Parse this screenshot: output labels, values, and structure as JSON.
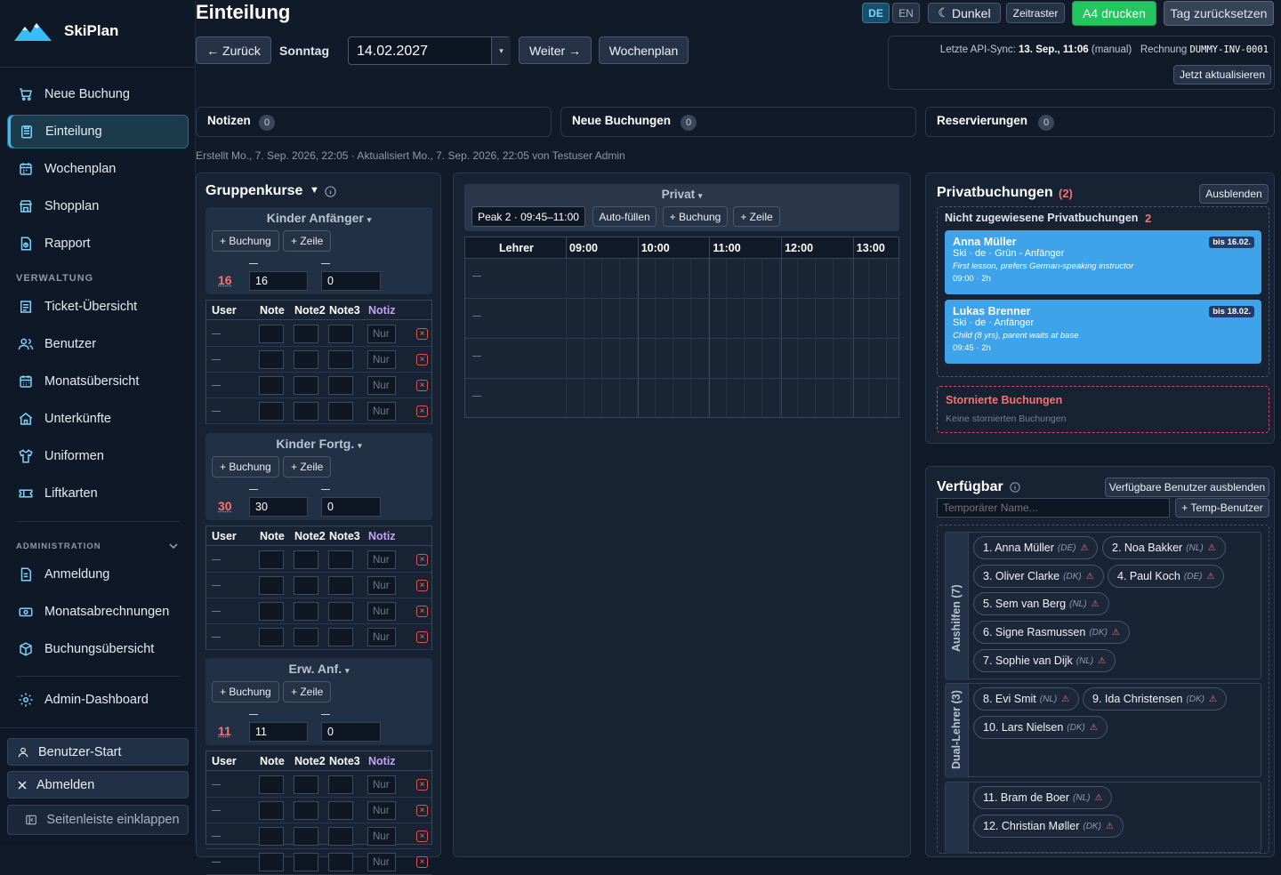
{
  "app": {
    "name": "SkiPlan"
  },
  "nav": {
    "items": [
      {
        "label": "Neue Buchung"
      },
      {
        "label": "Einteilung"
      },
      {
        "label": "Wochenplan"
      },
      {
        "label": "Shopplan"
      },
      {
        "label": "Rapport"
      }
    ],
    "section_verwaltung": "VERWALTUNG",
    "verwaltung": [
      {
        "label": "Ticket-Übersicht"
      },
      {
        "label": "Benutzer"
      },
      {
        "label": "Monatsübersicht"
      },
      {
        "label": "Unterkünfte"
      },
      {
        "label": "Uniformen"
      },
      {
        "label": "Liftkarten"
      }
    ],
    "section_admin": "ADMINISTRATION",
    "admin": [
      {
        "label": "Anmeldung"
      },
      {
        "label": "Monatsabrechnungen"
      },
      {
        "label": "Buchungsübersicht"
      }
    ],
    "dashboard": "Admin-Dashboard",
    "user_start": "Benutzer-Start",
    "logout": "Abmelden",
    "collapse": "Seitenleiste einklappen"
  },
  "header": {
    "title": "Einteilung",
    "lang_de": "DE",
    "lang_en": "EN",
    "dark": "Dunkel",
    "zeitraster": "Zeitraster",
    "print": "A4 drucken",
    "reset": "Tag zurücksetzen"
  },
  "datebar": {
    "back": "← Zurück",
    "day": "Sonntag",
    "date": "14.02.2027",
    "next": "Weiter →",
    "week": "Wochenplan"
  },
  "sync": {
    "prefix": "Letzte API-Sync:",
    "time": "13. Sep., 11:06",
    "mode": "(manual)",
    "invoice_label": "Rechnung",
    "invoice": "DUMMY-INV-0001",
    "refresh": "Jetzt aktualisieren"
  },
  "tabs": [
    {
      "label": "Notizen",
      "count": "0"
    },
    {
      "label": "Neue Buchungen",
      "count": "0"
    },
    {
      "label": "Reservierungen",
      "count": "0"
    }
  ],
  "meta": "Erstellt Mo., 7. Sep. 2026, 22:05 · Aktualisiert Mo., 7. Sep. 2026, 22:05 von Testuser Admin",
  "gruppenkurse": {
    "title": "Gruppenkurse",
    "buchung": "+ Buchung",
    "zeile": "+ Zeile",
    "cols": {
      "user": "User",
      "note": "Note",
      "note2": "Note2",
      "note3": "Note3",
      "notiz": "Notiz"
    },
    "nur": "Nur",
    "groups": [
      {
        "name": "Kinder Anfänger",
        "count": "16",
        "v1": "16",
        "v2": "0"
      },
      {
        "name": "Kinder Fortg.",
        "count": "30",
        "v1": "30",
        "v2": "0"
      },
      {
        "name": "Erw. Anf.",
        "count": "11",
        "v1": "11",
        "v2": "0"
      }
    ]
  },
  "privat": {
    "title": "Privat",
    "peak": "Peak 2 · 09:45–11:00",
    "autofill": "Auto-füllen",
    "buchung": "+ Buchung",
    "zeile": "+ Zeile",
    "lehrer": "Lehrer",
    "hours": [
      "09:00",
      "10:00",
      "11:00",
      "12:00",
      "13:00"
    ]
  },
  "privatbuchungen": {
    "title": "Privatbuchungen",
    "count": "(2)",
    "hide": "Ausblenden",
    "unassigned_title": "Nicht zugewiesene Privatbuchungen",
    "unassigned_count": "2",
    "cards": [
      {
        "name": "Anna Müller",
        "sub": "Ski · de · Grün - Anfänger",
        "info": "First lesson, prefers German-speaking instructor",
        "time": "09:00 · 2h",
        "bis": "bis 16.02."
      },
      {
        "name": "Lukas Brenner",
        "sub": "Ski · de · Anfänger",
        "info": "Child (8 yrs), parent waits at base",
        "time": "09:45 · 2h",
        "bis": "bis 18.02."
      }
    ],
    "cancelled_title": "Stornierte Buchungen",
    "cancelled_empty": "Keine stornierten Buchungen"
  },
  "verfuegbar": {
    "title": "Verfügbar",
    "hide": "Verfügbare Benutzer ausblenden",
    "placeholder": "Temporärer Name...",
    "temp": "+ Temp-Benutzer",
    "groups": [
      {
        "label": "Aushilfen (7)",
        "people": [
          {
            "name": "1. Anna Müller",
            "code": "(DE)"
          },
          {
            "name": "2. Noa Bakker",
            "code": "(NL)"
          },
          {
            "name": "3. Oliver Clarke",
            "code": "(DK)"
          },
          {
            "name": "4. Paul Koch",
            "code": "(DE)"
          },
          {
            "name": "5. Sem van Berg",
            "code": "(NL)"
          },
          {
            "name": "6. Signe Rasmussen",
            "code": "(DK)"
          },
          {
            "name": "7. Sophie van Dijk",
            "code": "(NL)"
          }
        ]
      },
      {
        "label": "Dual-Lehrer (3)",
        "people": [
          {
            "name": "8. Evi Smit",
            "code": "(NL)"
          },
          {
            "name": "9. Ida Christensen",
            "code": "(DK)"
          },
          {
            "name": "10. Lars Nielsen",
            "code": "(DK)"
          }
        ]
      },
      {
        "label": "",
        "people": [
          {
            "name": "11. Bram de Boer",
            "code": "(NL)"
          },
          {
            "name": "12. Christian Møller",
            "code": "(DK)"
          }
        ]
      }
    ],
    "warn": "⚠"
  },
  "colors": {
    "accent": "#38bdf8",
    "success": "#22c55e",
    "danger": "#f87171",
    "card": "#3ea3e8"
  }
}
